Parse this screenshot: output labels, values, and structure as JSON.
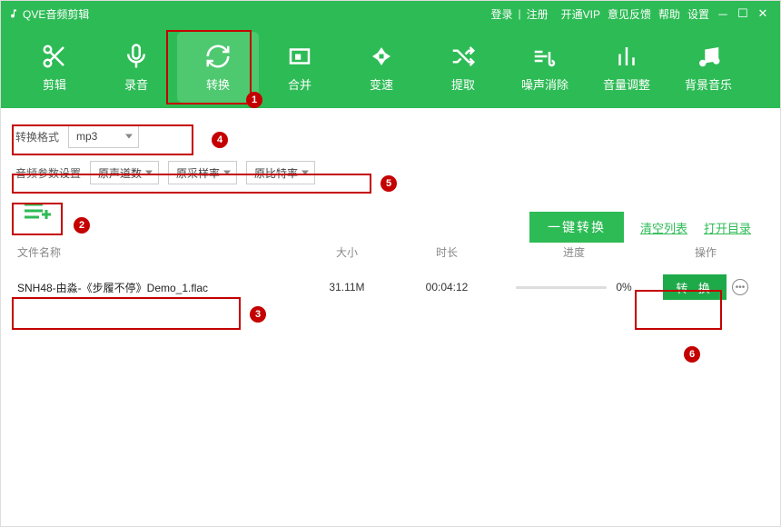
{
  "app": {
    "title": "QVE音频剪辑"
  },
  "title_links": {
    "login": "登录",
    "register": "注册",
    "vip": "开通VIP",
    "feedback": "意见反馈",
    "help": "帮助",
    "settings": "设置"
  },
  "toolbar": [
    {
      "id": "cut",
      "label": "剪辑"
    },
    {
      "id": "record",
      "label": "录音"
    },
    {
      "id": "convert",
      "label": "转换",
      "active": true
    },
    {
      "id": "merge",
      "label": "合并"
    },
    {
      "id": "speed",
      "label": "变速"
    },
    {
      "id": "extract",
      "label": "提取"
    },
    {
      "id": "denoise",
      "label": "噪声消除"
    },
    {
      "id": "volume",
      "label": "音量调整"
    },
    {
      "id": "bgm",
      "label": "背景音乐"
    }
  ],
  "convert": {
    "format_label": "转换格式",
    "format_value": "mp3",
    "params_label": "音频参数设置",
    "channels": "原声道数",
    "samplerate": "原采样率",
    "bitrate": "原比特率"
  },
  "actions": {
    "batch": "一键转换",
    "clear": "清空列表",
    "opendir": "打开目录"
  },
  "table": {
    "headers": {
      "name": "文件名称",
      "size": "大小",
      "duration": "时长",
      "progress": "进度",
      "action": "操作"
    },
    "rows": [
      {
        "name": "SNH48-由淼-《步履不停》Demo_1.flac",
        "size": "31.11M",
        "duration": "00:04:12",
        "progress": "0%",
        "action": "转 换"
      }
    ]
  },
  "annotations": [
    "1",
    "2",
    "3",
    "4",
    "5",
    "6"
  ]
}
